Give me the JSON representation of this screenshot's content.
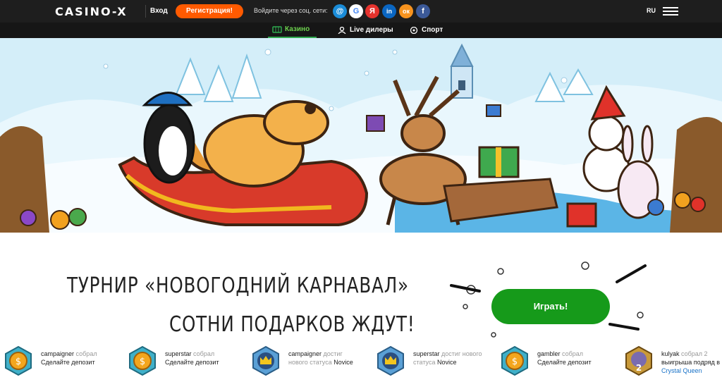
{
  "header": {
    "logo": "CASINO-X",
    "login": "Вход",
    "register": "Регистрация!",
    "social_label": "Войдите через соц. сети:",
    "social": [
      {
        "name": "mail-icon",
        "glyph": "@",
        "color": "#1a8cd8"
      },
      {
        "name": "google-icon",
        "glyph": "G",
        "color": "#ffffff"
      },
      {
        "name": "yandex-icon",
        "glyph": "Я",
        "color": "#e6322d"
      },
      {
        "name": "linkedin-icon",
        "glyph": "in",
        "color": "#0a66c2"
      },
      {
        "name": "odnoklassniki-icon",
        "glyph": "ок",
        "color": "#f7931e"
      },
      {
        "name": "facebook-icon",
        "glyph": "f",
        "color": "#3b5998"
      }
    ],
    "lang": "RU"
  },
  "nav": {
    "casino": "Казино",
    "live": "Live дилеры",
    "sport": "Спорт"
  },
  "promo": {
    "title": "ТУРНИР «НОВОГОДНИЙ КАРНАВАЛ»",
    "subtitle": "СОТНИ ПОДАРКОВ ЖДУТ!",
    "play": "Играть!"
  },
  "feed": [
    {
      "user": "campaigner",
      "action": "собрал",
      "line2": "Сделайте депозит",
      "link": "",
      "badge": "coin"
    },
    {
      "user": "superstar",
      "action": "собрал",
      "line2": "Сделайте депозит",
      "link": "",
      "badge": "coin"
    },
    {
      "user": "campaigner",
      "action": "достиг",
      "line2": "нового статуса",
      "status": "Novice",
      "link": "",
      "badge": "crown"
    },
    {
      "user": "superstar",
      "action": "достиг нового",
      "line2": "статуса",
      "status": "Novice",
      "link": "",
      "badge": "crown"
    },
    {
      "user": "gambler",
      "action": "собрал",
      "line2": "Сделайте депозит",
      "link": "",
      "badge": "coin"
    },
    {
      "user": "kulyak",
      "action": "собрал 2",
      "line2": "выигрыша подряд в",
      "link": "Crystal Queen",
      "badge": "crystal"
    }
  ],
  "colors": {
    "accent_orange": "#ff5a00",
    "play_green": "#169a1a",
    "nav_active": "#6dd14e",
    "link_blue": "#1a73c8"
  }
}
